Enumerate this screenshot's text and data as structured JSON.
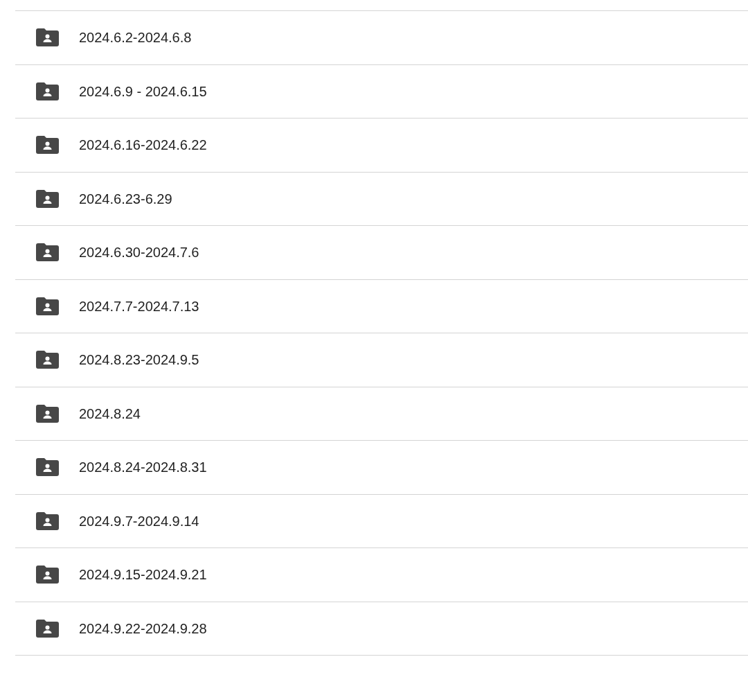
{
  "folders": [
    {
      "name": "2024.6.2-2024.6.8"
    },
    {
      "name": "2024.6.9 - 2024.6.15"
    },
    {
      "name": "2024.6.16-2024.6.22"
    },
    {
      "name": "2024.6.23-6.29"
    },
    {
      "name": "2024.6.30-2024.7.6"
    },
    {
      "name": "2024.7.7-2024.7.13"
    },
    {
      "name": "2024.8.23-2024.9.5"
    },
    {
      "name": "2024.8.24"
    },
    {
      "name": "2024.8.24-2024.8.31"
    },
    {
      "name": "2024.9.7-2024.9.14"
    },
    {
      "name": "2024.9.15-2024.9.21"
    },
    {
      "name": "2024.9.22-2024.9.28"
    }
  ]
}
